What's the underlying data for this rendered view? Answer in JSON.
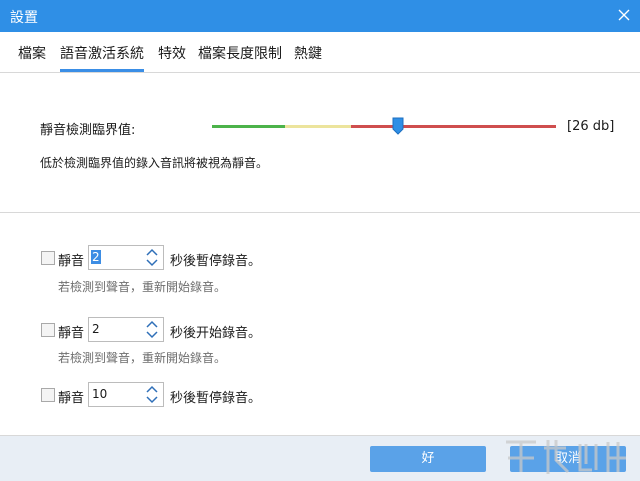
{
  "window": {
    "title": "設置"
  },
  "tabs": [
    {
      "label": "檔案"
    },
    {
      "label": "語音激活系統"
    },
    {
      "label": "特效"
    },
    {
      "label": "檔案長度限制"
    },
    {
      "label": "熱鍵"
    }
  ],
  "threshold": {
    "label": "靜音檢測臨界值:",
    "value_text": "[26 db]",
    "level_fraction": 0.54,
    "description": "低於檢測臨界值的錄入音訊將被視為靜音。",
    "colors": {
      "low": "#4cb34a",
      "mid": "#ece49c",
      "high": "#cf4e4e",
      "thumb": "#2f8fe6"
    }
  },
  "rules": [
    {
      "checked": false,
      "prefix": "靜音",
      "value": "2",
      "suffix": "秒後暫停錄音。",
      "note": "若檢測到聲音，重新開始錄音。"
    },
    {
      "checked": false,
      "prefix": "靜音",
      "value": "2",
      "suffix": "秒後开始錄音。",
      "note": "若檢測到聲音，重新開始錄音。"
    },
    {
      "checked": false,
      "prefix": "靜音",
      "value": "10",
      "suffix": "秒後暫停錄音。"
    }
  ],
  "buttons": {
    "ok": "好",
    "cancel": "取消"
  },
  "colors": {
    "titlebar": "#2f8fe6",
    "button": "#5aa2e8",
    "footer": "#e8eef5"
  }
}
